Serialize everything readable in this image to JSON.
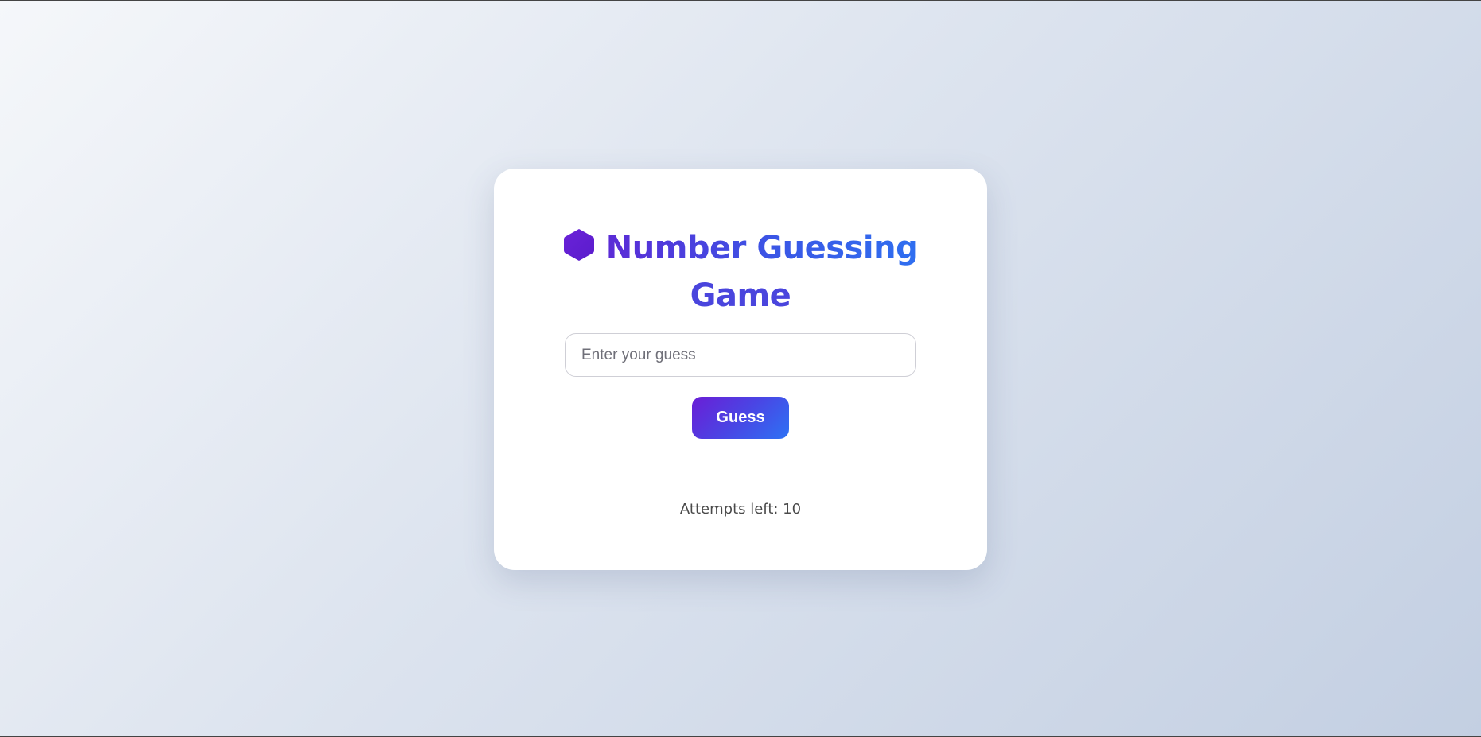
{
  "game": {
    "title_line_1": "Number Guessing",
    "title_line_2": "Game",
    "title_icon": "hexagon-icon",
    "input_placeholder": "Enter your guess",
    "input_value": "",
    "guess_button_label": "Guess",
    "attempts_text": "Attempts left: 10"
  },
  "colors": {
    "accent_purple": "#5b2bd6",
    "accent_blue": "#2f6ff0",
    "card_background": "#ffffff",
    "text_muted": "#4a4a4a"
  }
}
